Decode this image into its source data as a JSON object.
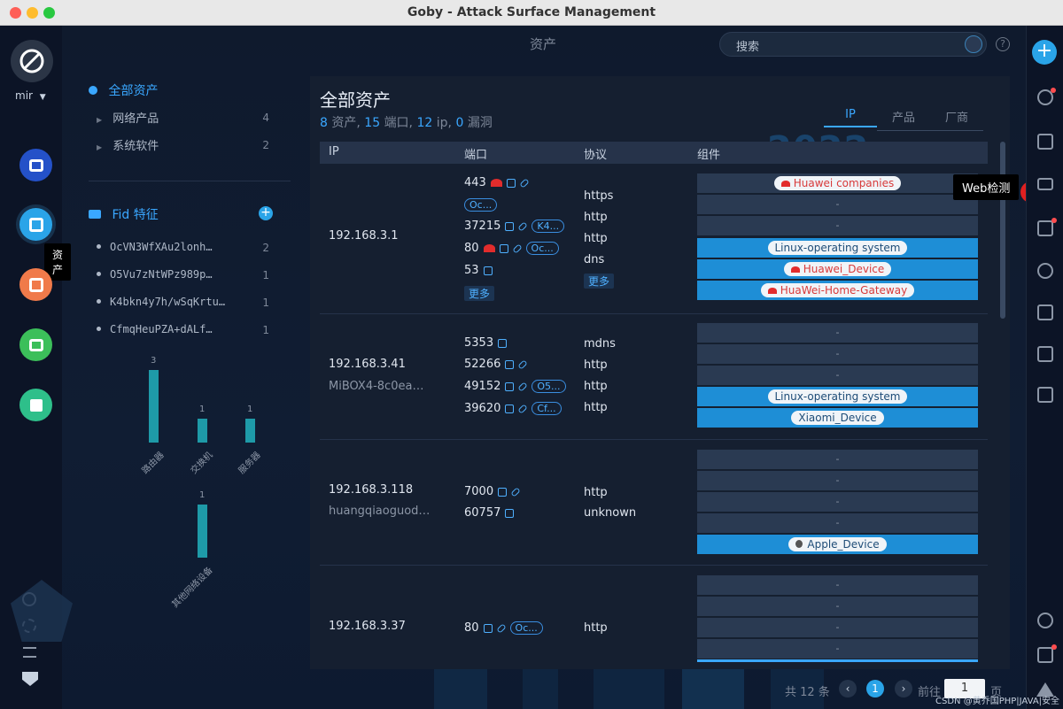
{
  "window": {
    "title": "Goby - Attack Surface Management"
  },
  "sidebar": {
    "user": "mir",
    "tooltip": "资产"
  },
  "topbar": {
    "title": "资产",
    "search_placeholder": "搜索",
    "help": "?"
  },
  "tree": {
    "root": "全部资产",
    "items": [
      {
        "label": "网络产品",
        "count": "4"
      },
      {
        "label": "系统软件",
        "count": "2"
      }
    ]
  },
  "fid": {
    "title": "Fid 特征",
    "items": [
      {
        "label": "OcVN3WfXAu2lonh…",
        "count": "2"
      },
      {
        "label": "O5Vu7zNtWPz989p…",
        "count": "1"
      },
      {
        "label": "K4bkn4y7h/wSqKrtu…",
        "count": "1"
      },
      {
        "label": "CfmqHeuPZA+dALf…",
        "count": "1"
      }
    ]
  },
  "chart_data": [
    {
      "type": "bar",
      "categories": [
        "路由器",
        "交换机",
        "服务器"
      ],
      "values": [
        3,
        1,
        1
      ]
    },
    {
      "type": "bar",
      "categories": [
        "其他网络设备"
      ],
      "values": [
        1
      ]
    }
  ],
  "panel": {
    "title": "全部资产",
    "summary": {
      "assets_n": "8",
      "assets_l": "资产, ",
      "ports_n": "15",
      "ports_l": "端口, ",
      "ips_n": "12",
      "ips_l": "ip, ",
      "vulns_n": "0",
      "vulns_l": "漏洞"
    },
    "tabs": [
      "IP",
      "产品",
      "厂商"
    ],
    "year_badge": "2022",
    "columns": {
      "ip": "IP",
      "port": "端口",
      "proto": "协议",
      "comp": "组件"
    }
  },
  "assets": [
    {
      "ip": "192.168.3.1",
      "host": "",
      "ports": [
        {
          "port": "443",
          "tag": ""
        },
        {
          "port": "",
          "tag": "Oc..."
        },
        {
          "port": "37215",
          "tag": "K4..."
        },
        {
          "port": "80",
          "tag": "Oc..."
        },
        {
          "port": "53",
          "tag": ""
        }
      ],
      "protocols": [
        "https",
        "http",
        "http",
        "dns"
      ],
      "more_ports": "更多",
      "more_protos": "更多",
      "components": [
        "Huawei companies",
        "-",
        "-",
        "Linux-operating system",
        "Huawei_Device",
        "HuaWei-Home-Gateway"
      ]
    },
    {
      "ip": "192.168.3.41",
      "host": "MiBOX4-8c0ea…",
      "ports": [
        {
          "port": "5353",
          "tag": ""
        },
        {
          "port": "52266",
          "tag": ""
        },
        {
          "port": "49152",
          "tag": "O5..."
        },
        {
          "port": "39620",
          "tag": "Cf..."
        }
      ],
      "protocols": [
        "mdns",
        "http",
        "http",
        "http"
      ],
      "components": [
        "-",
        "-",
        "-",
        "Linux-operating system",
        "Xiaomi_Device"
      ]
    },
    {
      "ip": "192.168.3.118",
      "host": "huangqiaoguod…",
      "ports": [
        {
          "port": "7000",
          "tag": ""
        },
        {
          "port": "60757",
          "tag": ""
        }
      ],
      "protocols": [
        "http",
        "unknown"
      ],
      "components": [
        "-",
        "-",
        "-",
        "-",
        "Apple_Device"
      ]
    },
    {
      "ip": "192.168.3.37",
      "host": "",
      "ports": [
        {
          "port": "80",
          "tag": "Oc..."
        }
      ],
      "protocols": [
        "http"
      ],
      "components": [
        "-",
        "-",
        "-",
        "-"
      ]
    }
  ],
  "tooltip_web": "Web检测",
  "badge": "1",
  "footer": {
    "total": "共 12 条",
    "page": "1",
    "goto": "前往",
    "page_input": "1",
    "page_unit": "页",
    "watermark": "CSDN @黄乔国PHP|JAVA|安全"
  },
  "colors": {
    "accent": "#1e8ed6",
    "teal_bar": "#1e9aa8",
    "danger": "#e22c2c"
  }
}
